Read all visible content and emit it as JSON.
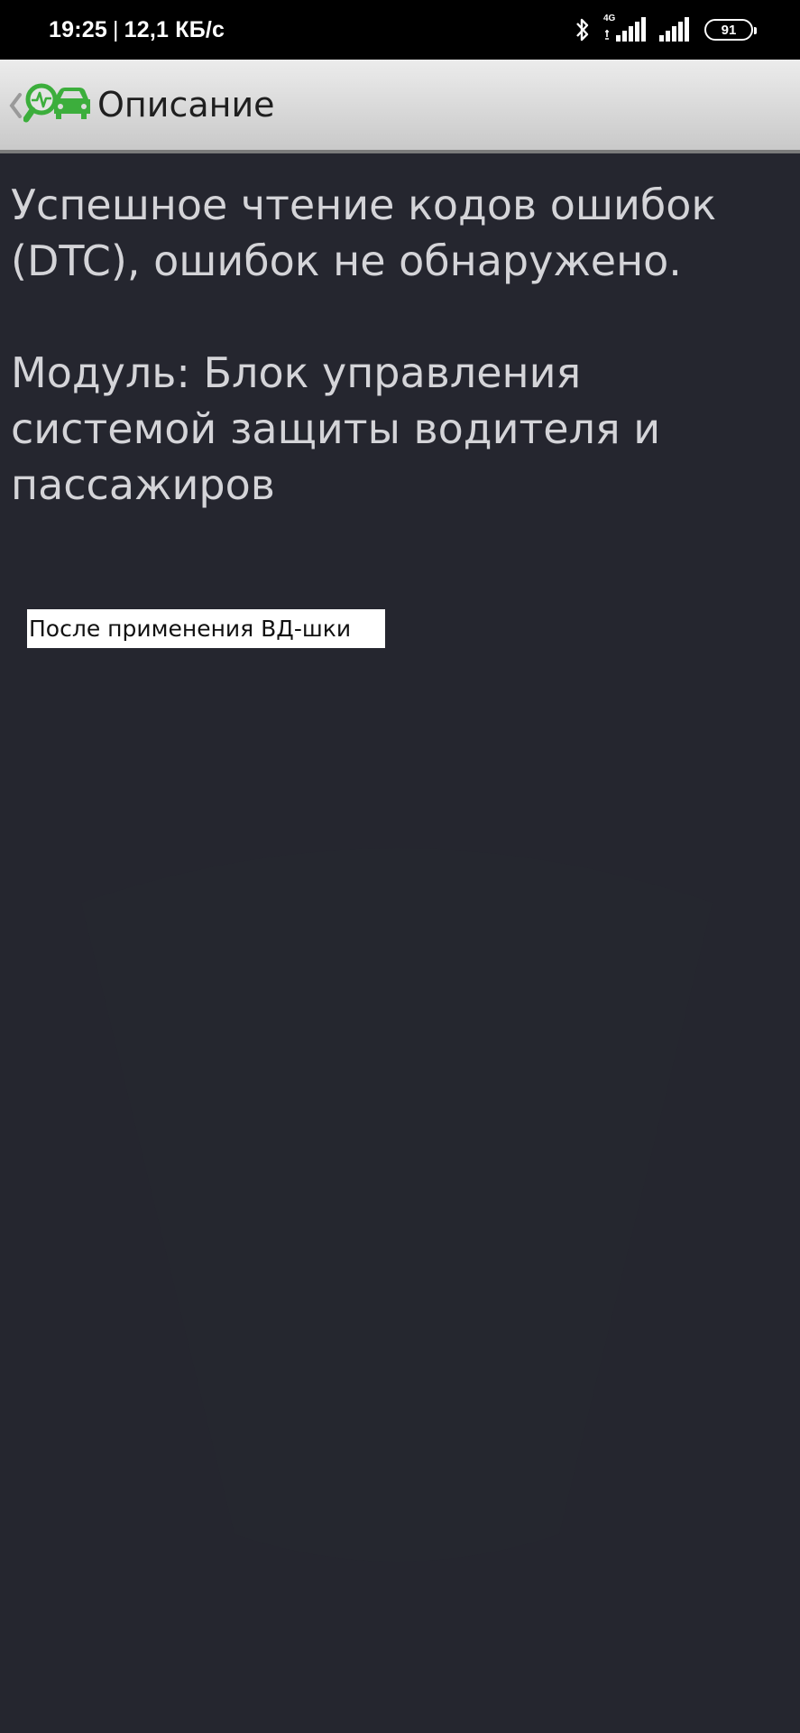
{
  "status_bar": {
    "time": "19:25",
    "separator": "|",
    "net_speed": "12,1 КБ/с",
    "network_type": "4G",
    "battery_level": "91"
  },
  "app_bar": {
    "title": "Описание",
    "logo_icon": "magnifier-car-diagnostic-icon",
    "accent_color": "#3cae3c"
  },
  "content": {
    "line1": "Успешное чтение кодов ошибок (DTC), ошибок не обнаружено.",
    "line2": "Модуль: Блок управления системой защиты водителя и пассажиров"
  },
  "overlay_note": "После применения ВД-шки",
  "colors": {
    "background": "#25262f",
    "text": "#d4d4d8",
    "app_bar_top": "#ececec",
    "app_bar_bottom": "#c9c9c9"
  }
}
